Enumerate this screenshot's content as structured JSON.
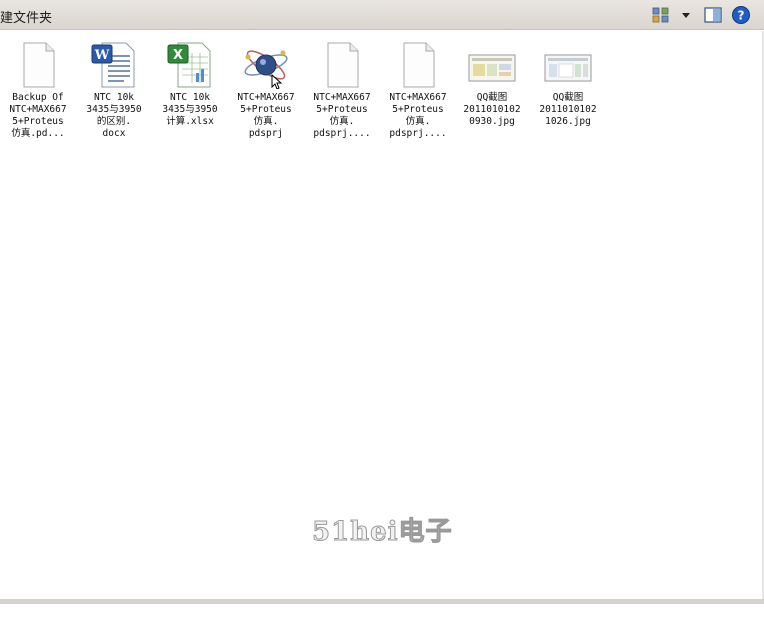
{
  "toolbar": {
    "new_folder_label": "建文件夹",
    "view_icon": "grid-view-icon",
    "view_dropdown_icon": "chevron-down-icon",
    "preview_icon": "preview-pane-icon",
    "help_icon": "help-icon"
  },
  "files": [
    {
      "label": "Backup Of\nNTC+MAX667\n5+Proteus\n仿真.pd...",
      "icon": "blank-file-icon"
    },
    {
      "label": "NTC 10k\n3435与3950\n的区别.\ndocx",
      "icon": "word-document-icon"
    },
    {
      "label": "NTC 10k\n3435与3950\n计算.xlsx",
      "icon": "excel-spreadsheet-icon"
    },
    {
      "label": "NTC+MAX667\n5+Proteus\n仿真.\npdsprj",
      "icon": "proteus-project-icon"
    },
    {
      "label": "NTC+MAX667\n5+Proteus\n仿真.\npdsprj....",
      "icon": "blank-file-icon"
    },
    {
      "label": "NTC+MAX667\n5+Proteus\n仿真.\npdsprj....",
      "icon": "blank-file-icon"
    },
    {
      "label": "QQ截图\n2011010102\n0930.jpg",
      "icon": "image-thumbnail-icon"
    },
    {
      "label": "QQ截图\n2011010102\n1026.jpg",
      "icon": "image-thumbnail-icon"
    }
  ],
  "watermark": "51hei电子",
  "colors": {
    "toolbar_bg": "#dad5cf",
    "help_blue": "#1f5ebf"
  }
}
